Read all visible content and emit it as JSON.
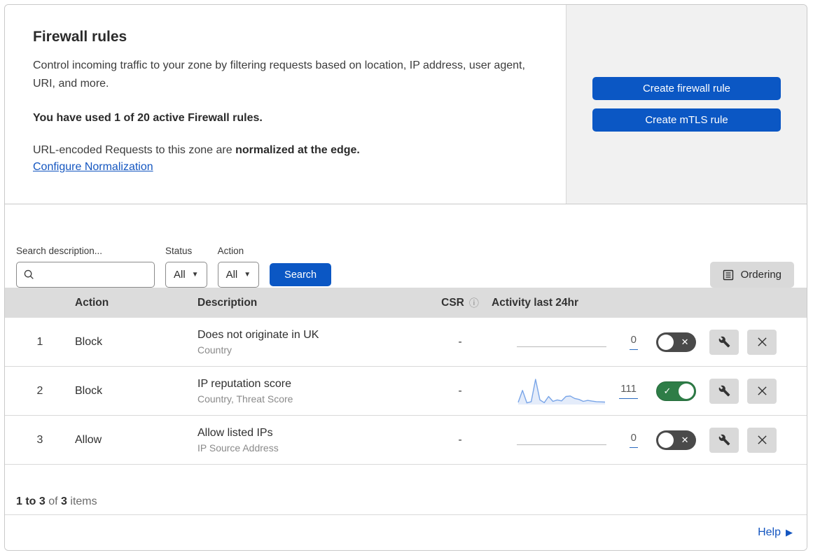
{
  "header": {
    "title": "Firewall rules",
    "description": "Control incoming traffic to your zone by filtering requests based on location, IP address, user agent, URI, and more.",
    "usage": "You have used 1 of 20 active Firewall rules.",
    "normalization_prefix": "URL-encoded Requests to this zone are ",
    "normalization_bold": "normalized at the edge.",
    "normalization_link": "Configure Normalization",
    "create_firewall_button": "Create firewall rule",
    "create_mtls_button": "Create mTLS rule"
  },
  "filters": {
    "search_label": "Search description...",
    "search_value": "",
    "status_label": "Status",
    "status_value": "All",
    "action_label": "Action",
    "action_value": "All",
    "search_button": "Search",
    "ordering_button": "Ordering"
  },
  "table": {
    "columns": {
      "action": "Action",
      "description": "Description",
      "csr": "CSR",
      "activity": "Activity last 24hr"
    },
    "rows": [
      {
        "num": "1",
        "action": "Block",
        "title": "Does not originate in UK",
        "subtitle": "Country",
        "csr": "-",
        "activity_count": "0",
        "enabled": false,
        "has_sparkline": false
      },
      {
        "num": "2",
        "action": "Block",
        "title": "IP reputation score",
        "subtitle": "Country, Threat Score",
        "csr": "-",
        "activity_count": "111",
        "enabled": true,
        "has_sparkline": true
      },
      {
        "num": "3",
        "action": "Allow",
        "title": "Allow listed IPs",
        "subtitle": "IP Source Address",
        "csr": "-",
        "activity_count": "0",
        "enabled": false,
        "has_sparkline": false
      }
    ]
  },
  "chart_data": {
    "type": "area",
    "title": "Activity last 24hr sparkline for rule 2 (IP reputation score)",
    "values": [
      6,
      55,
      4,
      9,
      100,
      16,
      5,
      30,
      10,
      16,
      12,
      30,
      32,
      22,
      18,
      10,
      14,
      11,
      9,
      8,
      7
    ],
    "total_label": "111",
    "xlabel": "",
    "ylabel": "",
    "axes_visible": false,
    "line_color": "#79a5e8",
    "fill_color": "rgba(107,152,226,0.18)"
  },
  "footer": {
    "range_bold": "1 to 3",
    "of_text": " of ",
    "total_bold": "3",
    "items_text": " items",
    "help_label": "Help"
  },
  "icons": {
    "toggle_off_glyph": "✕",
    "toggle_on_glyph": "✓",
    "dropdown_caret": "▼",
    "info_glyph": "ⓘ",
    "help_arrow": "▶"
  },
  "colors": {
    "primary_blue": "#0b57c4",
    "link_blue": "#1456c0",
    "toggle_on_green": "#2e7d47",
    "toggle_off_gray": "#4a4a4a",
    "table_header_bg": "#dcdcdc",
    "panel_bg": "#f1f1f1",
    "gray_button_bg": "#d9d9d9",
    "sparkline_blue": "#79a5e8"
  }
}
